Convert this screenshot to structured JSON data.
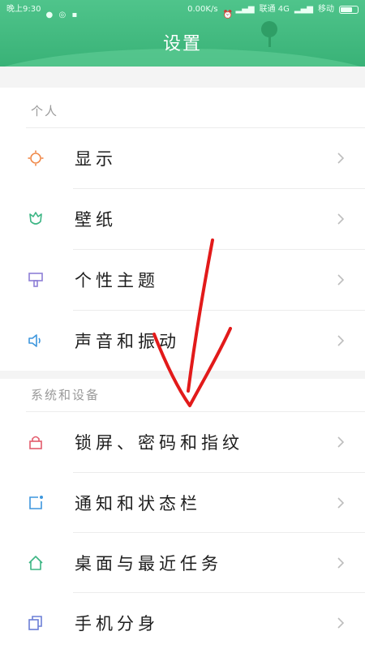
{
  "status_bar": {
    "time": "晚上9:30",
    "speed": "0.00K/s",
    "carrier1": "联通 4G",
    "carrier2": "移动"
  },
  "header": {
    "title": "设置"
  },
  "sections": [
    {
      "label": "个人",
      "items": [
        {
          "name": "display",
          "label": "显示",
          "icon": "sun-icon",
          "color": "#f0894a"
        },
        {
          "name": "wallpaper",
          "label": "壁纸",
          "icon": "tulip-icon",
          "color": "#3cb584"
        },
        {
          "name": "theme",
          "label": "个性主题",
          "icon": "brush-icon",
          "color": "#8e7fd6"
        },
        {
          "name": "sound",
          "label": "声音和振动",
          "icon": "speaker-icon",
          "color": "#3d96dd"
        }
      ]
    },
    {
      "label": "系统和设备",
      "items": [
        {
          "name": "lock",
          "label": "锁屏、密码和指纹",
          "icon": "lock-icon",
          "color": "#e35b6c"
        },
        {
          "name": "notifications",
          "label": "通知和状态栏",
          "icon": "notification-icon",
          "color": "#3d96dd"
        },
        {
          "name": "desktop",
          "label": "桌面与最近任务",
          "icon": "home-icon",
          "color": "#3cb584"
        },
        {
          "name": "dual-apps",
          "label": "手机分身",
          "icon": "copy-icon",
          "color": "#6c7fd6"
        }
      ]
    }
  ],
  "colors": {
    "header": "#3fb67c",
    "annotation_arrow": "#e21a1a"
  }
}
